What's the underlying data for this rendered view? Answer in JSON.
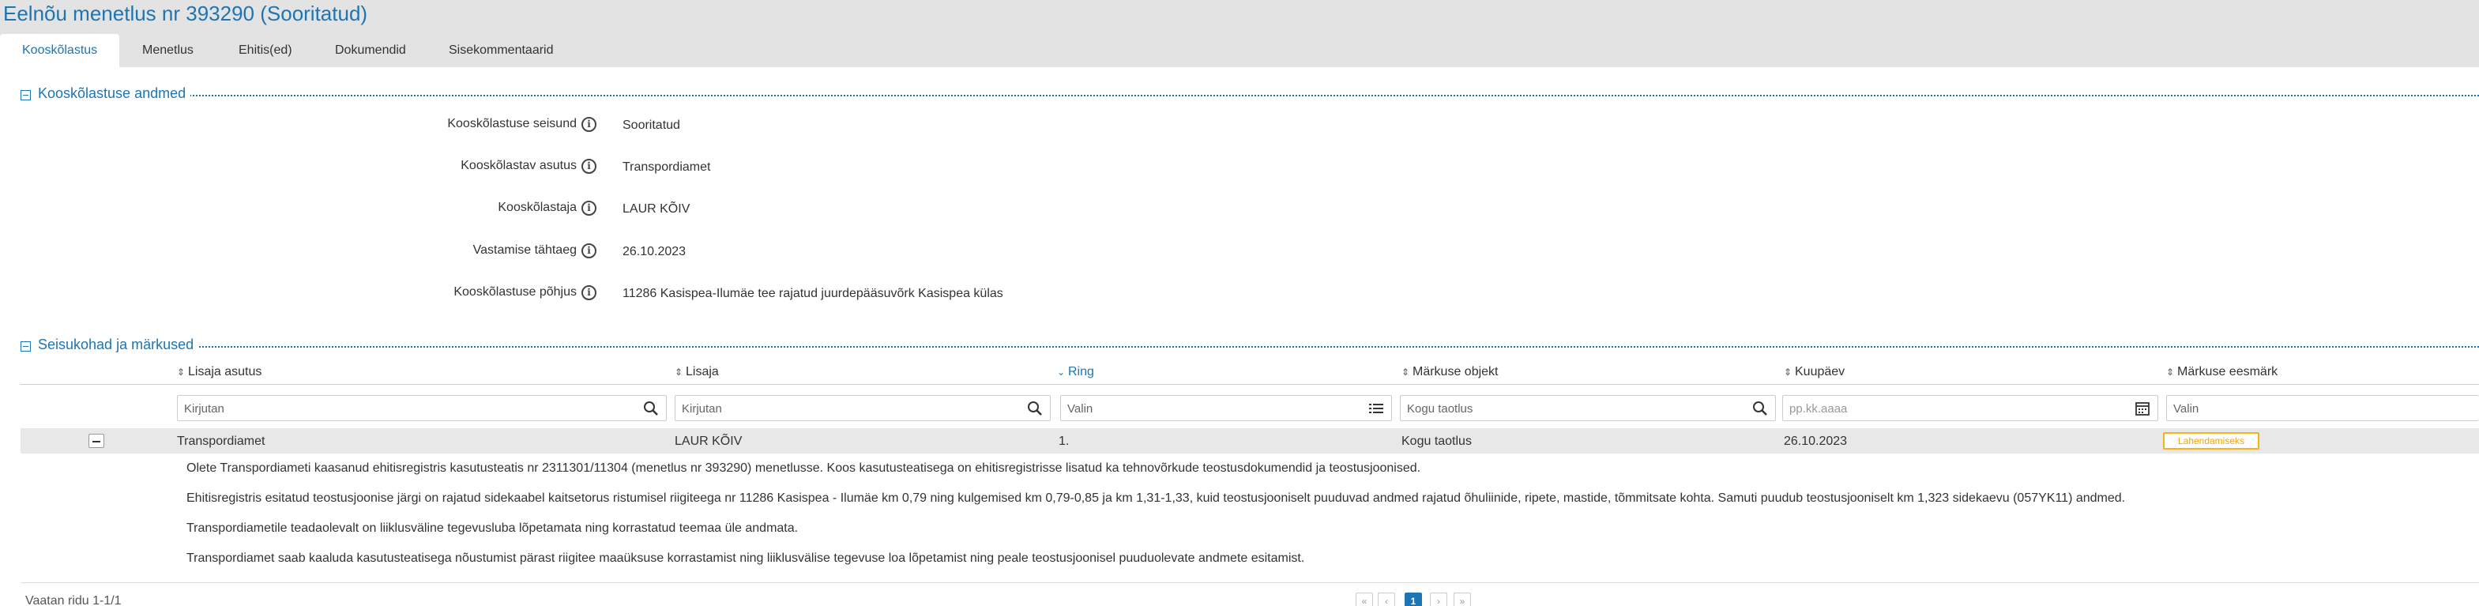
{
  "page": {
    "title": "Eelnõu menetlus nr 393290 (Sooritatud)"
  },
  "tabs": [
    {
      "label": "Kooskõlastus",
      "active": true
    },
    {
      "label": "Menetlus",
      "active": false
    },
    {
      "label": "Ehitis(ed)",
      "active": false
    },
    {
      "label": "Dokumendid",
      "active": false
    },
    {
      "label": "Sisekommentaarid",
      "active": false
    }
  ],
  "details": {
    "section_title": "Kooskõlastuse andmed",
    "fields": [
      {
        "label": "Kooskõlastuse seisund",
        "value": "Sooritatud"
      },
      {
        "label": "Kooskõlastav asutus",
        "value": "Transpordiamet"
      },
      {
        "label": "Kooskõlastaja",
        "value": "LAUR KÕIV"
      },
      {
        "label": "Vastamise tähtaeg",
        "value": "26.10.2023"
      },
      {
        "label": "Kooskõlastuse põhjus",
        "value": "11286 Kasispea-Ilumäe tee rajatud juurdepääsuvõrk Kasispea külas"
      }
    ]
  },
  "remarks": {
    "section_title": "Seisukohad ja märkused",
    "columns": [
      {
        "label": "Lisaja asutus",
        "sort_icon": "sort-icon"
      },
      {
        "label": "Lisaja",
        "sort_icon": "sort-icon"
      },
      {
        "label": "Ring",
        "sort_icon": "sort-desc-icon"
      },
      {
        "label": "Märkuse objekt",
        "sort_icon": "sort-icon"
      },
      {
        "label": "Kuupäev",
        "sort_icon": "sort-icon"
      },
      {
        "label": "Märkuse eesmärk",
        "sort_icon": "sort-icon"
      }
    ],
    "filters": [
      {
        "placeholder": "Kirjutan",
        "icon": "search-icon"
      },
      {
        "placeholder": "Kirjutan",
        "icon": "search-icon"
      },
      {
        "placeholder": "Valin",
        "icon": "list-icon"
      },
      {
        "placeholder": "Kirjutan",
        "value": "Kogu taotlus",
        "icon": "search-icon"
      },
      {
        "placeholder": "pp.kk.aaaa",
        "icon": "calendar-icon"
      },
      {
        "placeholder": "Valin",
        "icon": ""
      }
    ],
    "rows": [
      {
        "asutus": "Transpordiamet",
        "lisaja": "LAUR KÕIV",
        "ring": "1.",
        "objekt": "Kogu taotlus",
        "kuupaev": "26.10.2023",
        "eesmark": "Lahendamiseks",
        "comment_lines": [
          "Olete Transpordiameti kaasanud ehitisregistris kasutusteatis nr 2311301/11304 (menetlus nr 393290) menetlusse. Koos kasutusteatisega on ehitisregistrisse lisatud ka tehnovõrkude teostusdokumendid ja teostusjoonised.",
          "Ehitisregistris esitatud teostusjoonise järgi on rajatud sidekaabel kaitsetorus ristumisel riigiteega nr 11286 Kasispea - Ilumäe km 0,79 ning kulgemised km 0,79-0,85 ja km 1,31-1,33, kuid teostusjooniselt puuduvad andmed rajatud õhuliinide, ripete, mastide, tõmmitsate kohta. Samuti puudub teostusjooniselt km 1,323 sidekaevu (057YK11) andmed.",
          "Transpordiametile teadaolevalt on liiklusväline tegevusluba lõpetamata ning korrastatud teemaa üle andmata.",
          "Transpordiamet saab kaaluda kasutusteatisega nõustumist pärast riigitee maaüksuse korrastamist ning liiklusvälise tegevuse loa lõpetamist ning peale teostusjoonisel puuduolevate andmete esitamist."
        ]
      }
    ],
    "footer_text": "Vaatan ridu 1-1/1",
    "pager": {
      "current_page": "1"
    }
  },
  "colors": {
    "accent": "#1d75b3",
    "badge": "#f5b21b",
    "tab_bar": "#e3e3e3",
    "row_bg": "#e8e8e8"
  }
}
